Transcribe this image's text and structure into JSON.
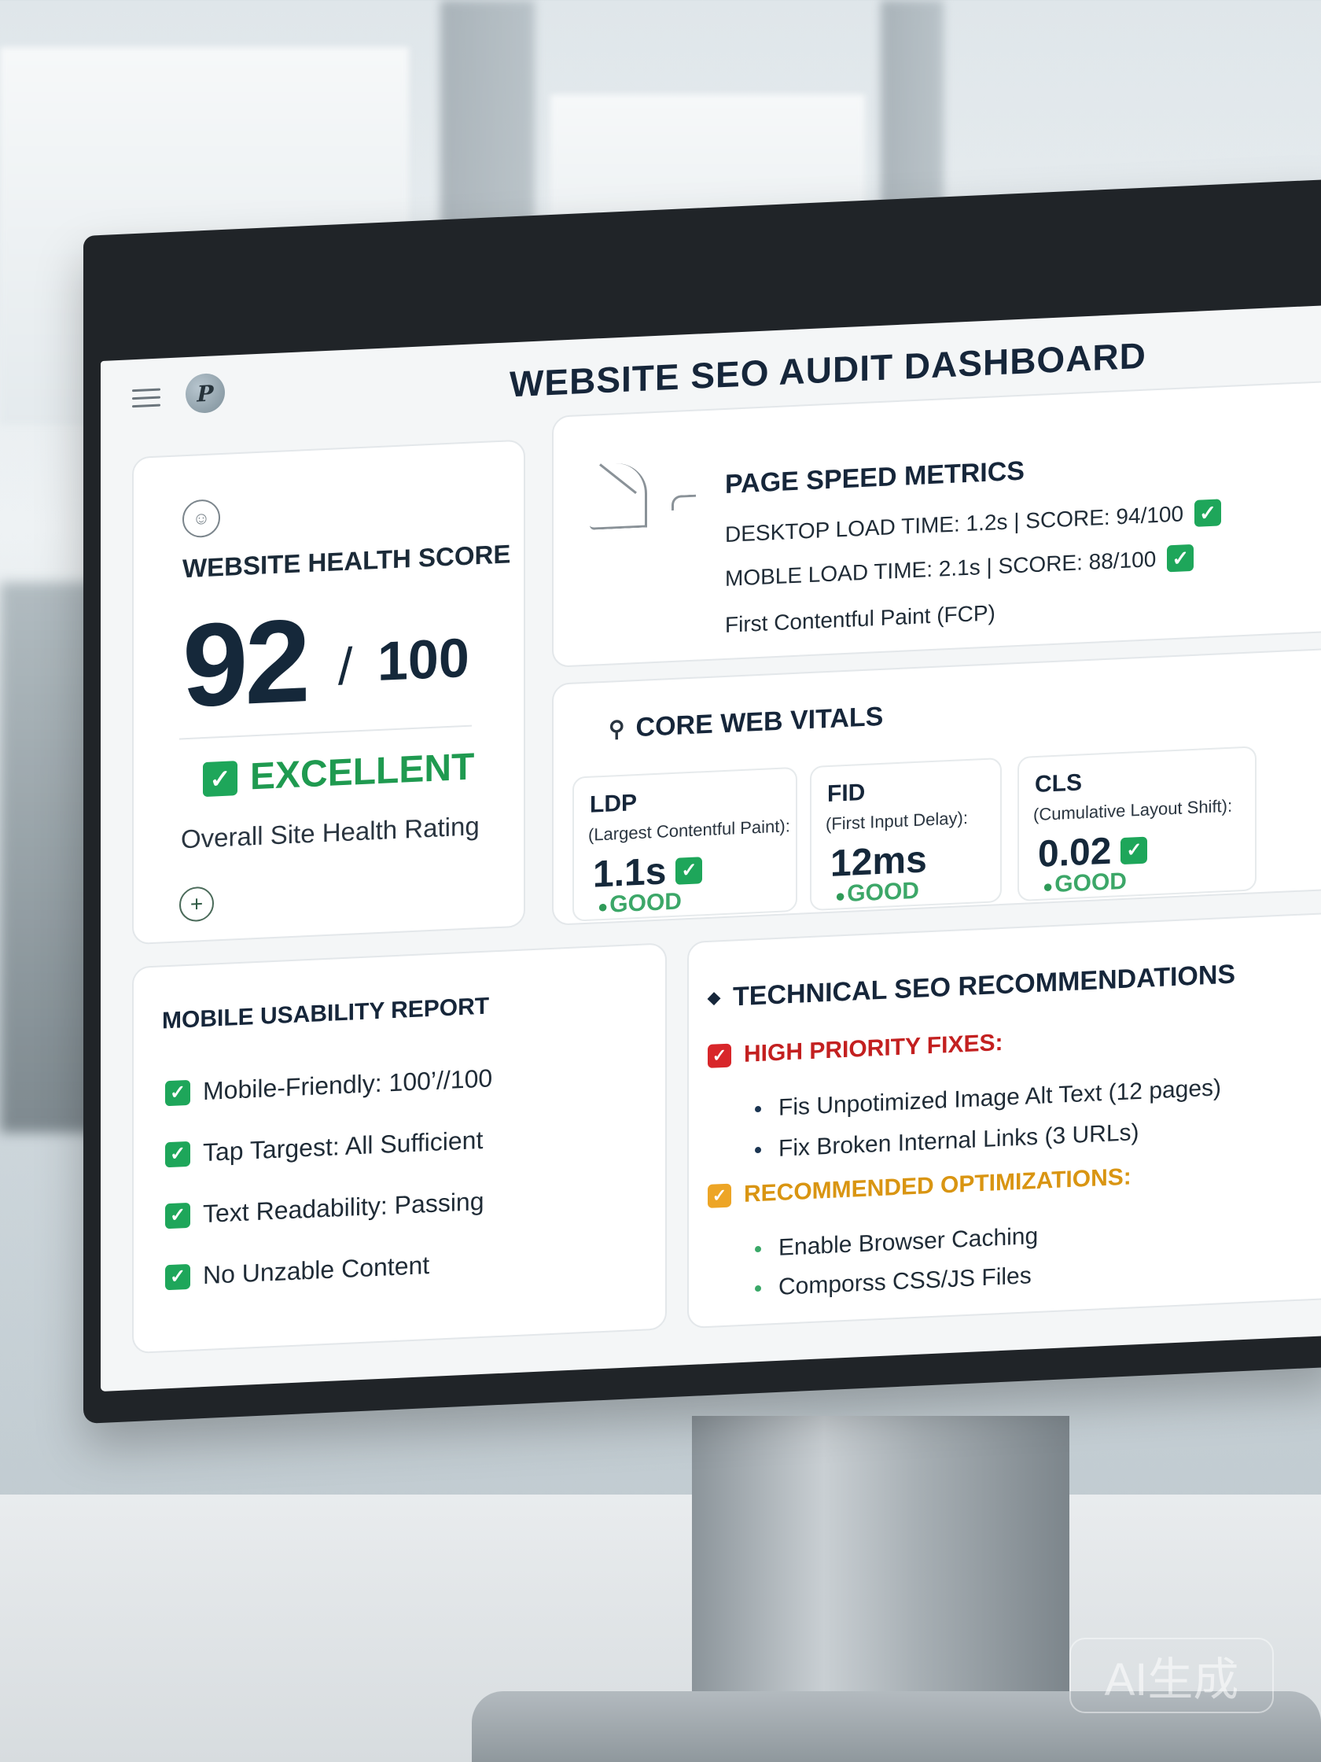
{
  "header": {
    "title": "WEBSITE SEO AUDIT DASHBOARD"
  },
  "health": {
    "label": "WEBSITE HEALTH SCORE",
    "score": "92",
    "slash": "/",
    "max": "100",
    "rating": "EXCELLENT",
    "rating_sub": "Overall Site Health Rating"
  },
  "speed": {
    "title": "PAGE SPEED METRICS",
    "desktop": "DESKTOP LOAD TIME: 1.2s | SCORE: 94/100",
    "mobile": "MOBLE LOAD TIME:  2.1s | SCORE: 88/100",
    "fcp": "First Contentful Paint (FCP)"
  },
  "vitals": {
    "title": "CORE WEB VITALS",
    "metrics": [
      {
        "abbr": "LDP",
        "full": "(Largest Contentful Paint):",
        "value": "1.1s",
        "status": "GOOD"
      },
      {
        "abbr": "FID",
        "full": "(First Input Delay):",
        "value": "12ms",
        "status": "GOOD"
      },
      {
        "abbr": "CLS",
        "full": "(Cumulative Layout Shift):",
        "value": "0.02",
        "status": "GOOD"
      }
    ]
  },
  "mobile": {
    "title": "MOBILE USABILITY REPORT",
    "items": [
      "Mobile-Friendly: 100’//100",
      "Tap Targest: All Sufficient",
      "Text Readability: Passing",
      "No Unzable Content"
    ]
  },
  "tech": {
    "title": "TECHNICAL SEO RECOMMENDATIONS",
    "high_label": "HIGH PRIORITY FIXES:",
    "high_items": [
      "Fis Unpotimized Image Alt Text (12 pages)",
      "Fix Broken Internal Links (3 URLs)"
    ],
    "rec_label": "RECOMMENDED OPTIMIZATIONS:",
    "rec_items": [
      "Enable Browser Caching",
      "Comporss CSS/JS Files"
    ]
  },
  "watermark": "AI生成",
  "colors": {
    "good_green": "#1ea65a",
    "high_priority_red": "#c32020",
    "recommended_amber": "#d99512",
    "title_navy": "#16263a"
  },
  "icons": [
    "menu-icon",
    "logo-icon",
    "smile-icon",
    "check-icon",
    "add-icon",
    "tool-icon",
    "pin-icon",
    "leaf-icon",
    "diamond-icon",
    "alert-icon"
  ]
}
